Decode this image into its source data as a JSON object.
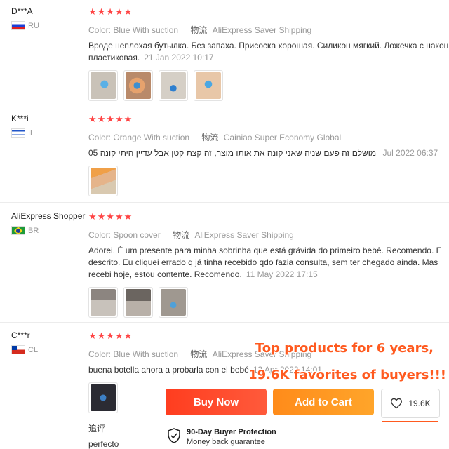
{
  "reviews": [
    {
      "user": "D***A",
      "country": "RU",
      "stars": "★★★★★",
      "color_label": "Color: Blue With suction",
      "wuliu": "物流",
      "shipping": "AliExpress Saver Shipping",
      "text_line1": "Вроде неплохая бутылка. Без запаха. Присоска хорошая. Силикон мягкий. Ложечка с након",
      "text_line2": "пластиковая.",
      "date": "21 Jan 2022 10:17"
    },
    {
      "user": "K***i",
      "country": "IL",
      "stars": "★★★★★",
      "color_label": "Color: Orange With suction",
      "wuliu": "物流",
      "shipping": "Cainiao Super Economy Global",
      "text_line1": "מושלם זה פעם שניה שאני קונה את אותו מוצר, זה קצת קטן אבל עדיין היתי קונה 05",
      "date": "Jul 2022 06:37"
    },
    {
      "user": "AliExpress Shopper",
      "country": "BR",
      "stars": "★★★★★",
      "color_label": "Color: Spoon cover",
      "wuliu": "物流",
      "shipping": "AliExpress Saver Shipping",
      "text_line1": "Adorei. É um presente para minha sobrinha que está grávida do primeiro bebê. Recomendo. E",
      "text_line2": "descrito. Eu cliquei errado q já tinha recebido qdo fazia consulta, sem ter chegado ainda. Mas",
      "text_line3": "recebi hoje, estou contente. Recomendo.",
      "date": "11 May 2022 17:15"
    },
    {
      "user": "C***r",
      "country": "CL",
      "stars": "★★★★★",
      "color_label": "Color: Blue With suction",
      "wuliu": "物流",
      "shipping": "AliExpress Saver Shipping",
      "text_line1": "buena botella ahora a probarla con el bebé",
      "date": "13 Apr 2022 14:01"
    }
  ],
  "followup_label": "追评",
  "followup_text": "perfecto",
  "promo": {
    "line1": "Top products for 6 years,",
    "line2": "19.6K favorites of buyers!!!"
  },
  "actions": {
    "buy_now": "Buy Now",
    "add_to_cart": "Add to Cart",
    "favorites_count": "19.6K"
  },
  "protection": {
    "title": "90-Day Buyer Protection",
    "subtitle": "Money back guarantee"
  },
  "colors": {
    "star": "#ff4444",
    "buy_now": "#ff4a2a",
    "add_to_cart": "#ff9a22",
    "promo": "#ff5a1f"
  }
}
